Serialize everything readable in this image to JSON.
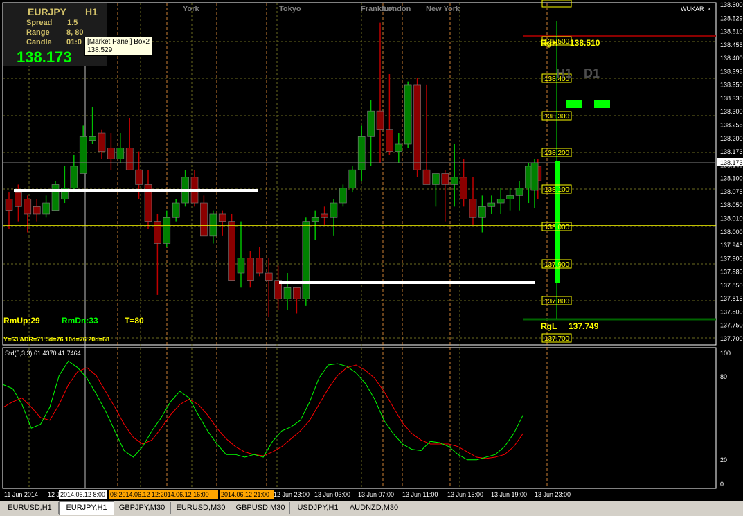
{
  "panel": {
    "symbol": "EURJPY",
    "timeframe": "H1",
    "spread_label": "Spread",
    "spread": "1.5",
    "range_label": "Range",
    "range": "8, 80",
    "candle_label": "Candle",
    "candle": "01:0",
    "price": "138.173"
  },
  "tooltip": {
    "title": "[Market Panel] Box2",
    "value": "138.529"
  },
  "sessions": {
    "york": "York",
    "tokyo": "Tokyo",
    "frankfurt": "Frankfurt",
    "london": "London",
    "newyork": "New York"
  },
  "levels": {
    "rgh_label": "RgH",
    "rgh": "138.510",
    "rgl_label": "RgL",
    "rgl": "137.749",
    "tf_h1": "H1",
    "tf_d1": "D1",
    "pivot_boxes": [
      "138.500",
      "138.400",
      "138.300",
      "138.200",
      "138.100",
      "138.000",
      "137.900",
      "137.800",
      "137.700"
    ]
  },
  "stats": {
    "rmup": "RmUp:29",
    "rmdn": "RmDn:33",
    "t": "T=80",
    "adr": "Y=63 ADR=71 5d=76 10d=76 20d=68"
  },
  "broker": "WUKAR",
  "indicator": {
    "label": "Std(5,3,3) 61.4370 41.7464",
    "levels": [
      "100",
      "80",
      "20",
      "0"
    ]
  },
  "price_axis": [
    "138.600",
    "138.529",
    "138.510",
    "138.455",
    "138.400",
    "138.395",
    "138.350",
    "138.330",
    "138.300",
    "138.255",
    "138.200",
    "138.173",
    "138.140",
    "138.100",
    "138.075",
    "138.050",
    "138.010",
    "138.000",
    "137.945",
    "137.900",
    "137.880",
    "137.850",
    "137.815",
    "137.800",
    "137.750",
    "137.700"
  ],
  "time_axis": [
    {
      "label": "11 Jun 2014",
      "hl": "none"
    },
    {
      "label": "12 Jun",
      "hl": "none"
    },
    {
      "label": "2014.06.12 8:00",
      "hl": "white"
    },
    {
      "label": "08:2014.06.12 12:2014.06.12 16:00",
      "hl": "orange"
    },
    {
      "label": "2014.06.12 21:00",
      "hl": "orange"
    },
    {
      "label": "12 Jun 23:00",
      "hl": "none"
    },
    {
      "label": "13 Jun 03:00",
      "hl": "none"
    },
    {
      "label": "13 Jun 07:00",
      "hl": "none"
    },
    {
      "label": "13 Jun 11:00",
      "hl": "none"
    },
    {
      "label": "13 Jun 15:00",
      "hl": "none"
    },
    {
      "label": "13 Jun 19:00",
      "hl": "none"
    },
    {
      "label": "13 Jun 23:00",
      "hl": "none"
    }
  ],
  "tabs": [
    "EURUSD,H1",
    "EURJPY,H1",
    "GBPJPY,M30",
    "EURUSD,M30",
    "GBPUSD,M30",
    "USDJPY,H1",
    "AUDNZD,M30"
  ],
  "active_tab": 1,
  "colors": {
    "bull": "#008000",
    "bear": "#8b0000",
    "main": "#00ff00",
    "signal": "#ff0000",
    "level": "#ffff00"
  },
  "chart_data": {
    "type": "candlestick",
    "ylim": [
      137.69,
      138.61
    ],
    "candles": [
      {
        "o": 138.08,
        "h": 138.1,
        "l": 138.0,
        "c": 138.05
      },
      {
        "o": 138.1,
        "h": 138.12,
        "l": 138.02,
        "c": 138.06
      },
      {
        "o": 138.08,
        "h": 138.09,
        "l": 137.99,
        "c": 138.04
      },
      {
        "o": 138.06,
        "h": 138.08,
        "l": 138.02,
        "c": 138.04
      },
      {
        "o": 138.04,
        "h": 138.09,
        "l": 138.03,
        "c": 138.07
      },
      {
        "o": 138.05,
        "h": 138.13,
        "l": 138.05,
        "c": 138.12
      },
      {
        "o": 138.08,
        "h": 138.17,
        "l": 138.07,
        "c": 138.11
      },
      {
        "o": 138.11,
        "h": 138.2,
        "l": 138.1,
        "c": 138.17
      },
      {
        "o": 138.15,
        "h": 138.28,
        "l": 138.15,
        "c": 138.25
      },
      {
        "o": 138.24,
        "h": 138.33,
        "l": 138.23,
        "c": 138.25
      },
      {
        "o": 138.26,
        "h": 138.27,
        "l": 138.19,
        "c": 138.21
      },
      {
        "o": 138.22,
        "h": 138.26,
        "l": 138.16,
        "c": 138.19
      },
      {
        "o": 138.19,
        "h": 138.26,
        "l": 138.18,
        "c": 138.22
      },
      {
        "o": 138.22,
        "h": 138.3,
        "l": 138.16,
        "c": 138.16
      },
      {
        "o": 138.16,
        "h": 138.21,
        "l": 138.08,
        "c": 138.12
      },
      {
        "o": 138.12,
        "h": 138.16,
        "l": 138.0,
        "c": 138.02
      },
      {
        "o": 138.02,
        "h": 138.04,
        "l": 137.82,
        "c": 137.96
      },
      {
        "o": 137.96,
        "h": 138.05,
        "l": 137.95,
        "c": 138.03
      },
      {
        "o": 138.03,
        "h": 138.08,
        "l": 138.02,
        "c": 138.07
      },
      {
        "o": 138.07,
        "h": 138.16,
        "l": 138.06,
        "c": 138.14
      },
      {
        "o": 138.14,
        "h": 138.16,
        "l": 138.06,
        "c": 138.07
      },
      {
        "o": 138.07,
        "h": 138.09,
        "l": 137.98,
        "c": 137.98
      },
      {
        "o": 137.98,
        "h": 138.05,
        "l": 137.96,
        "c": 138.04
      },
      {
        "o": 138.04,
        "h": 138.05,
        "l": 137.98,
        "c": 138.02
      },
      {
        "o": 138.02,
        "h": 138.04,
        "l": 137.86,
        "c": 137.86
      },
      {
        "o": 137.88,
        "h": 138.02,
        "l": 137.84,
        "c": 137.92
      },
      {
        "o": 137.92,
        "h": 137.94,
        "l": 137.84,
        "c": 137.86
      },
      {
        "o": 137.92,
        "h": 137.95,
        "l": 137.87,
        "c": 137.88
      },
      {
        "o": 137.88,
        "h": 137.92,
        "l": 137.76,
        "c": 137.86
      },
      {
        "o": 137.86,
        "h": 137.9,
        "l": 137.78,
        "c": 137.81
      },
      {
        "o": 137.81,
        "h": 137.88,
        "l": 137.78,
        "c": 137.84
      },
      {
        "o": 137.84,
        "h": 137.84,
        "l": 137.77,
        "c": 137.81
      },
      {
        "o": 137.81,
        "h": 138.03,
        "l": 137.79,
        "c": 138.02
      },
      {
        "o": 138.02,
        "h": 138.05,
        "l": 137.97,
        "c": 138.03
      },
      {
        "o": 138.04,
        "h": 138.06,
        "l": 138.01,
        "c": 138.03
      },
      {
        "o": 138.03,
        "h": 138.08,
        "l": 137.98,
        "c": 138.07
      },
      {
        "o": 138.07,
        "h": 138.12,
        "l": 138.06,
        "c": 138.11
      },
      {
        "o": 138.11,
        "h": 138.17,
        "l": 138.1,
        "c": 138.16
      },
      {
        "o": 138.16,
        "h": 138.28,
        "l": 138.13,
        "c": 138.25
      },
      {
        "o": 138.25,
        "h": 138.35,
        "l": 138.17,
        "c": 138.32
      },
      {
        "o": 138.32,
        "h": 138.56,
        "l": 138.18,
        "c": 138.27
      },
      {
        "o": 138.27,
        "h": 138.42,
        "l": 138.2,
        "c": 138.21
      },
      {
        "o": 138.21,
        "h": 138.26,
        "l": 138.18,
        "c": 138.23
      },
      {
        "o": 138.23,
        "h": 138.4,
        "l": 138.22,
        "c": 138.39
      },
      {
        "o": 138.39,
        "h": 138.41,
        "l": 138.14,
        "c": 138.16
      },
      {
        "o": 138.16,
        "h": 138.39,
        "l": 138.12,
        "c": 138.12
      },
      {
        "o": 138.12,
        "h": 138.15,
        "l": 138.06,
        "c": 138.15
      },
      {
        "o": 138.15,
        "h": 138.16,
        "l": 138.02,
        "c": 138.12
      },
      {
        "o": 138.12,
        "h": 138.23,
        "l": 138.06,
        "c": 138.14
      },
      {
        "o": 138.14,
        "h": 138.19,
        "l": 138.06,
        "c": 138.08
      },
      {
        "o": 138.08,
        "h": 138.14,
        "l": 138.01,
        "c": 138.03
      },
      {
        "o": 138.03,
        "h": 138.09,
        "l": 137.99,
        "c": 138.06
      },
      {
        "o": 138.06,
        "h": 138.09,
        "l": 138.04,
        "c": 138.07
      },
      {
        "o": 138.07,
        "h": 138.11,
        "l": 138.04,
        "c": 138.08
      },
      {
        "o": 138.08,
        "h": 138.11,
        "l": 138.05,
        "c": 138.09
      },
      {
        "o": 138.09,
        "h": 138.13,
        "l": 138.05,
        "c": 138.11
      },
      {
        "o": 138.11,
        "h": 138.18,
        "l": 138.07,
        "c": 138.17
      },
      {
        "o": 138.17,
        "h": 138.19,
        "l": 138.08,
        "c": 138.13
      }
    ],
    "stoch_main": [
      75,
      72,
      60,
      42,
      45,
      58,
      82,
      93,
      88,
      80,
      68,
      55,
      40,
      25,
      20,
      28,
      40,
      50,
      62,
      70,
      65,
      52,
      40,
      30,
      22,
      22,
      20,
      22,
      20,
      32,
      40,
      43,
      48,
      62,
      80,
      90,
      91,
      89,
      84,
      76,
      64,
      48,
      38,
      30,
      26,
      25,
      32,
      31,
      28,
      22,
      18,
      18,
      20,
      22,
      28,
      38,
      52
    ],
    "stoch_signal": [
      58,
      62,
      65,
      58,
      50,
      48,
      60,
      75,
      85,
      88,
      82,
      70,
      58,
      45,
      35,
      30,
      33,
      42,
      52,
      60,
      64,
      60,
      52,
      42,
      34,
      28,
      24,
      22,
      21,
      24,
      28,
      34,
      40,
      48,
      60,
      72,
      82,
      88,
      90,
      86,
      80,
      70,
      58,
      46,
      38,
      33,
      30,
      30,
      30,
      28,
      24,
      20,
      19,
      20,
      22,
      28,
      38
    ]
  }
}
